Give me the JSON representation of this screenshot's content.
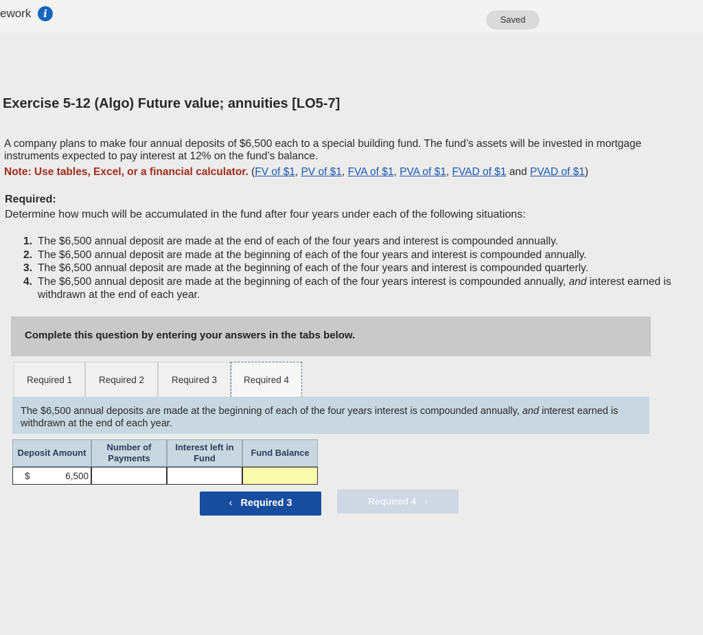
{
  "header": {
    "brand_fragment": "ework",
    "status": "Saved"
  },
  "question": {
    "title": "Exercise 5-12 (Algo) Future value; annuities [LO5-7]",
    "paragraph": "A company plans to make four annual deposits of $6,500 each to a special building fund. The fund’s assets will be invested in mortgage instruments expected to pay interest at 12% on the fund’s balance.",
    "note_label": "Note: Use tables, Excel, or a financial calculator.",
    "links": [
      "FV of $1",
      "PV of $1",
      "FVA of $1",
      "PVA of $1",
      "FVAD of $1",
      "PVAD of $1"
    ],
    "and_text": "and",
    "required_label": "Required:",
    "required_text": "Determine how much will be accumulated in the fund after four years under each of the following situations:",
    "items": [
      {
        "num": "1.",
        "text": "The $6,500 annual deposit are made at the end of each of the four years  and interest is compounded annually."
      },
      {
        "num": "2.",
        "text": "The $6,500 annual deposit are made at the beginning of each of the four years and interest is compounded annually."
      },
      {
        "num": "3.",
        "text": "The $6,500 annual deposit are made at the beginning of each of the four years and interest is compounded quarterly."
      },
      {
        "num": "4.",
        "text_a": "The $6,500 annual deposit are made at the beginning of each of the four years interest is compounded annually,",
        "text_em": "and",
        "text_b": "interest earned is withdrawn at the end of each year."
      }
    ]
  },
  "answer_area": {
    "banner": "Complete this question by entering your answers in the tabs below.",
    "tabs": [
      "Required 1",
      "Required 2",
      "Required 3",
      "Required 4"
    ],
    "active_tab": "Required 4",
    "description_a": "The $6,500 annual deposits are made at the beginning of each of the four years interest is compounded annually,",
    "description_em": "and",
    "description_b": "interest earned is withdrawn at the end of each year.",
    "columns": [
      "Deposit Amount",
      "Number of Payments",
      "Interest left in Fund",
      "Fund Balance"
    ],
    "row": {
      "currency": "$",
      "deposit": "6,500",
      "payments": "",
      "interest_left": "",
      "fund_balance": ""
    },
    "prev_button": "Required 3",
    "next_button": "Required 4"
  },
  "colors": {
    "accent": "#164d9e",
    "note_red": "#a12b1c",
    "answer_highlight": "#fbfbac"
  }
}
